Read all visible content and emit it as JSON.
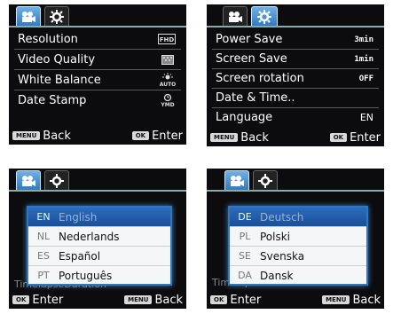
{
  "screen1": {
    "rows": [
      {
        "label": "Resolution",
        "icon": "fhd-icon"
      },
      {
        "label": "Video Quality",
        "icon": "quality-icon"
      },
      {
        "label": "White Balance",
        "icon": "auto-wb-icon"
      },
      {
        "label": "Date Stamp",
        "icon": "ymd-icon"
      }
    ],
    "footer": {
      "left_btn": "MENU",
      "left_label": "Back",
      "right_btn": "OK",
      "right_label": "Enter"
    }
  },
  "screen2": {
    "rows": [
      {
        "label": "Power Save",
        "value": "3min"
      },
      {
        "label": "Screen Save",
        "value": "1min"
      },
      {
        "label": "Screen rotation",
        "value": "OFF"
      },
      {
        "label": "Date & Time..",
        "value": ""
      },
      {
        "label": "Language",
        "value": "EN"
      }
    ],
    "footer": {
      "left_btn": "MENU",
      "left_label": "Back",
      "right_btn": "OK",
      "right_label": "Enter"
    }
  },
  "screen3": {
    "ghost_bottom": "TimelapseDuration",
    "languages": [
      {
        "code": "EN",
        "name": "English"
      },
      {
        "code": "NL",
        "name": "Nederlands"
      },
      {
        "code": "ES",
        "name": "Español"
      },
      {
        "code": "PT",
        "name": "Português"
      }
    ],
    "footer": {
      "left_btn": "OK",
      "left_label": "Enter",
      "right_btn": "MENU",
      "right_label": "Back"
    }
  },
  "screen4": {
    "ghost_bottom": "TimelapseDuration",
    "languages": [
      {
        "code": "DE",
        "name": "Deutsch"
      },
      {
        "code": "PL",
        "name": "Polski"
      },
      {
        "code": "SE",
        "name": "Svenska"
      },
      {
        "code": "DA",
        "name": "Dansk"
      }
    ],
    "footer": {
      "left_btn": "OK",
      "left_label": "Enter",
      "right_btn": "MENU",
      "right_label": "Back"
    }
  },
  "icons": {
    "video_tab": "video-camera-icon",
    "settings_tab": "gear-icon"
  },
  "colors": {
    "highlight": "#2f78be",
    "screen_bg": "#0c0c0e"
  }
}
